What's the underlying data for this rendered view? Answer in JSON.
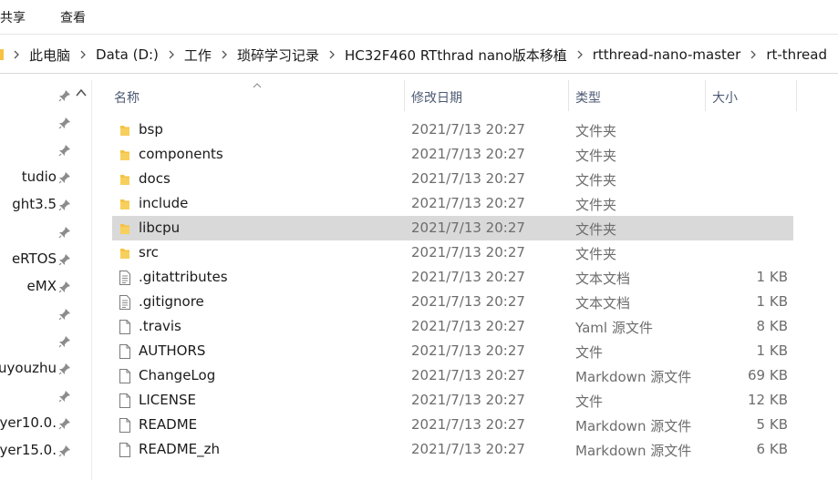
{
  "ribbon": {
    "tabs": [
      "共享",
      "查看"
    ]
  },
  "address": {
    "crumbs": [
      "此电脑",
      "Data (D:)",
      "工作",
      "琐碎学习记录",
      "HC32F460 RTthrad nano版本移植",
      "rtthread-nano-master",
      "rt-thread"
    ]
  },
  "nav": {
    "items": [
      "",
      "",
      "",
      "tudio",
      "ght3.5",
      "",
      "eRTOS",
      "eMX",
      "",
      "",
      "uyouzhu",
      "",
      "yer10.0.",
      "yer15.0."
    ]
  },
  "columns": {
    "name": "名称",
    "date": "修改日期",
    "type": "类型",
    "size": "大小"
  },
  "files": [
    {
      "name": "bsp",
      "date": "2021/7/13 20:27",
      "type": "文件夹",
      "size": "",
      "icon": "folder-icon"
    },
    {
      "name": "components",
      "date": "2021/7/13 20:27",
      "type": "文件夹",
      "size": "",
      "icon": "folder-icon"
    },
    {
      "name": "docs",
      "date": "2021/7/13 20:27",
      "type": "文件夹",
      "size": "",
      "icon": "folder-icon"
    },
    {
      "name": "include",
      "date": "2021/7/13 20:27",
      "type": "文件夹",
      "size": "",
      "icon": "folder-icon"
    },
    {
      "name": "libcpu",
      "date": "2021/7/13 20:27",
      "type": "文件夹",
      "size": "",
      "icon": "folder-icon",
      "selected": true
    },
    {
      "name": "src",
      "date": "2021/7/13 20:27",
      "type": "文件夹",
      "size": "",
      "icon": "folder-icon"
    },
    {
      "name": ".gitattributes",
      "date": "2021/7/13 20:27",
      "type": "文本文档",
      "size": "1 KB",
      "icon": "text-file-icon"
    },
    {
      "name": ".gitignore",
      "date": "2021/7/13 20:27",
      "type": "文本文档",
      "size": "1 KB",
      "icon": "text-file-icon"
    },
    {
      "name": ".travis",
      "date": "2021/7/13 20:27",
      "type": "Yaml 源文件",
      "size": "8 KB",
      "icon": "file-icon"
    },
    {
      "name": "AUTHORS",
      "date": "2021/7/13 20:27",
      "type": "文件",
      "size": "1 KB",
      "icon": "file-icon"
    },
    {
      "name": "ChangeLog",
      "date": "2021/7/13 20:27",
      "type": "Markdown 源文件",
      "size": "69 KB",
      "icon": "file-icon"
    },
    {
      "name": "LICENSE",
      "date": "2021/7/13 20:27",
      "type": "文件",
      "size": "12 KB",
      "icon": "file-icon"
    },
    {
      "name": "README",
      "date": "2021/7/13 20:27",
      "type": "Markdown 源文件",
      "size": "5 KB",
      "icon": "file-icon"
    },
    {
      "name": "README_zh",
      "date": "2021/7/13 20:27",
      "type": "Markdown 源文件",
      "size": "6 KB",
      "icon": "file-icon"
    }
  ],
  "colors": {
    "folder": "#f5c242",
    "selection": "#d9d9d9",
    "header_text": "#4d5a73"
  }
}
